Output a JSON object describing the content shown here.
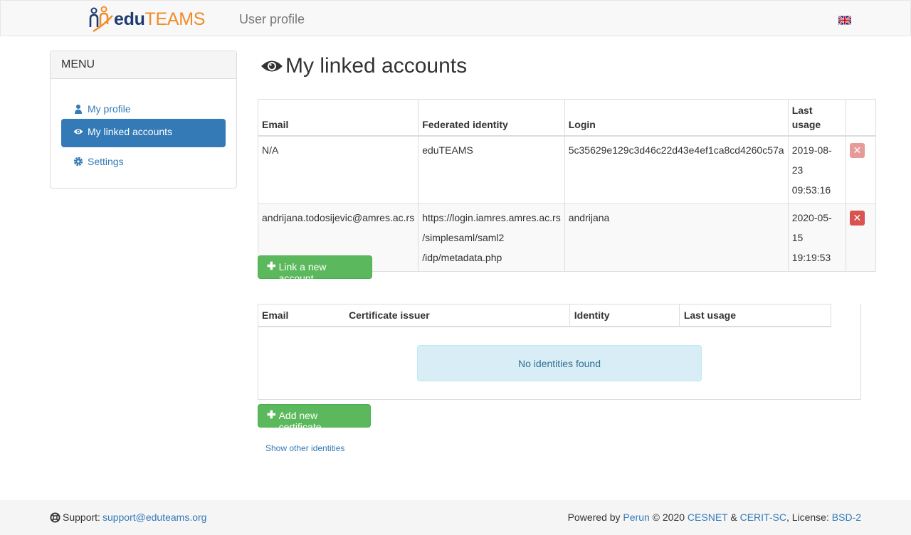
{
  "navbar": {
    "logo_edu": "edu",
    "logo_teams": "TEAMS",
    "title": "User profile",
    "language_icon": "uk-flag-icon"
  },
  "menu": {
    "heading": "MENU",
    "items": [
      {
        "label": "My profile",
        "icon": "user-icon"
      },
      {
        "label": "My linked accounts",
        "icon": "eye-icon"
      },
      {
        "label": "Settings",
        "icon": "gear-icon"
      }
    ]
  },
  "main": {
    "title": "My linked accounts",
    "accounts_table": {
      "headers": [
        "Email",
        "Federated identity",
        "Login",
        "Last usage"
      ],
      "rows": [
        {
          "email": "N/A",
          "federated_identity": "eduTEAMS",
          "login": "5c35629e129c3d46c22d43e4ef1ca8cd4260c57a",
          "last_usage_date": "2019-08-23",
          "last_usage_time": "09:53:16"
        },
        {
          "email": "andrijana.todosijevic@amres.ac.rs",
          "federated_identity_line1": "https://login.iamres.amres.ac.rs",
          "federated_identity_line2": "/simplesaml/saml2",
          "federated_identity_line3": "/idp/metadata.php",
          "login": "andrijana",
          "last_usage_date": "2020-05-15",
          "last_usage_time": "19:19:53"
        }
      ]
    },
    "link_account_label": "Link a new account",
    "cert_table": {
      "headers": [
        "Email",
        "Certificate issuer",
        "Identity",
        "Last usage"
      ],
      "empty_message": "No identities found"
    },
    "add_certificate_label": "Add new certificate",
    "show_other_label": "Show other identities"
  },
  "footer": {
    "support_label": "Support:",
    "support_email": "support@eduteams.org",
    "powered_by": "Powered by",
    "perun": "Perun",
    "copyright": "© 2020",
    "cesnet": "CESNET",
    "amp": "&",
    "cerit": "CERIT-SC",
    "license_label": ", License:",
    "license": "BSD-2"
  },
  "colors": {
    "primary": "#337ab7",
    "success": "#5cb85c",
    "danger": "#d9534f",
    "info_bg": "#d9edf7",
    "logo_blue": "#1e3a72",
    "logo_orange": "#f08c2a"
  }
}
